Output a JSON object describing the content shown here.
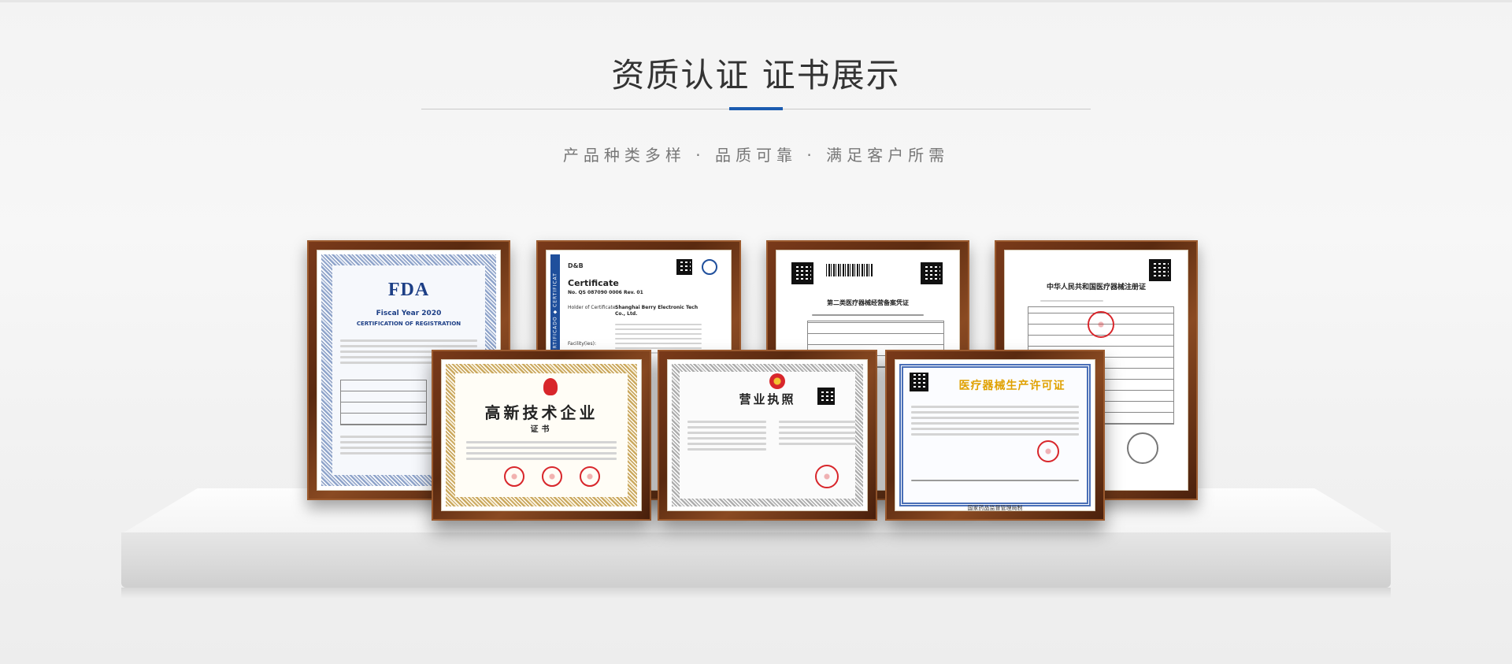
{
  "header": {
    "title": "资质认证 证书展示",
    "subtitle": "产品种类多样 · 品质可靠 · 满足客户所需"
  },
  "colors": {
    "accent": "#1b5bb0",
    "frame_wood": "#6a3214",
    "seal_red": "#d8262b"
  },
  "certificates": [
    {
      "id": "fda",
      "logo": "FDA",
      "line1": "Fiscal Year 2020",
      "line2": "CERTIFICATION OF REGISTRATION"
    },
    {
      "id": "dnb",
      "brand": "D&B",
      "heading": "Certificate",
      "number": "No. QS 087090 0006 Rev. 01",
      "holder_label": "Holder of Certificate:",
      "holder": "Shanghai Berry Electronic Tech Co., Ltd.",
      "facility_label": "Facility(ies):",
      "side_band": "CERTIFICATE ◆ CERTIFICADO ◆ CERTIFICAT"
    },
    {
      "id": "class2",
      "heading": "第二类医疗器械经营备案凭证"
    },
    {
      "id": "nmpa",
      "heading": "中华人民共和国医疗器械注册证"
    },
    {
      "id": "hightech",
      "line1": "高新技术企业",
      "line2": "证书"
    },
    {
      "id": "license",
      "line1": "营业执照"
    },
    {
      "id": "production",
      "line1": "医疗器械生产许可证",
      "footer": "国家药品监督管理局制"
    }
  ]
}
